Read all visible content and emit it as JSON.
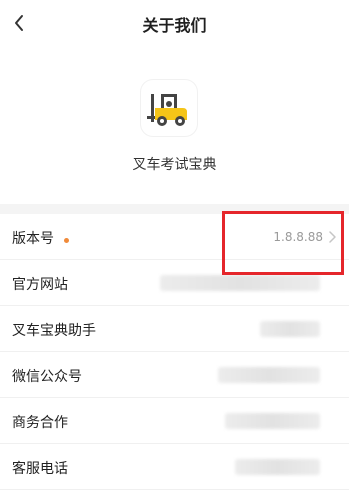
{
  "header": {
    "title": "关于我们",
    "back_icon": "chevron-left-icon"
  },
  "app": {
    "name": "叉车考试宝典",
    "icon": "forklift-icon",
    "brand_color": "#f5c518"
  },
  "list": {
    "items": [
      {
        "label": "版本号",
        "value": "1.8.8.88",
        "has_dot": true
      },
      {
        "label": "官方网站",
        "value": ""
      },
      {
        "label": "叉车宝典助手",
        "value": ""
      },
      {
        "label": "微信公众号",
        "value": ""
      },
      {
        "label": "商务合作",
        "value": ""
      },
      {
        "label": "客服电话",
        "value": ""
      }
    ]
  },
  "colors": {
    "dot": "#f08a3a",
    "highlight": "#e5262b"
  }
}
